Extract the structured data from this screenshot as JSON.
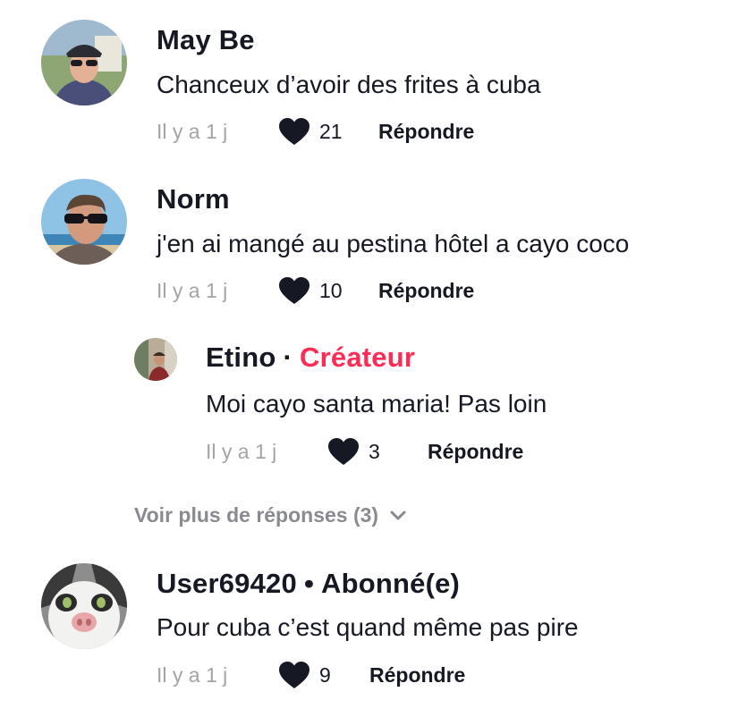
{
  "comments": [
    {
      "username": "May Be",
      "text": "Chanceux d’avoir des frites à cuba",
      "time": "Il y a 1 j",
      "likes": "21",
      "reply": "Répondre"
    },
    {
      "username": "Norm",
      "text": "j'en ai mangé au pestina hôtel a cayo coco",
      "time": "Il y a 1 j",
      "likes": "10",
      "reply": "Répondre"
    },
    {
      "username": "Etino",
      "separator": "·",
      "badge": "Créateur",
      "text": "Moi cayo santa maria! Pas loin",
      "time": "Il y a 1 j",
      "likes": "3",
      "reply": "Répondre"
    },
    {
      "username": "User69420",
      "separator": "•",
      "badge": "Abonné(e)",
      "text": "Pour cuba c’est quand même pas pire",
      "time": "Il y a 1 j",
      "likes": "9",
      "reply": "Répondre"
    }
  ],
  "view_more": "Voir plus de réponses (3)",
  "icons": {
    "like": "heart-icon",
    "expand": "chevron-down-icon"
  },
  "colors": {
    "text": "#161823",
    "muted": "#a3a4a8",
    "creator_badge": "#fe2c55"
  }
}
